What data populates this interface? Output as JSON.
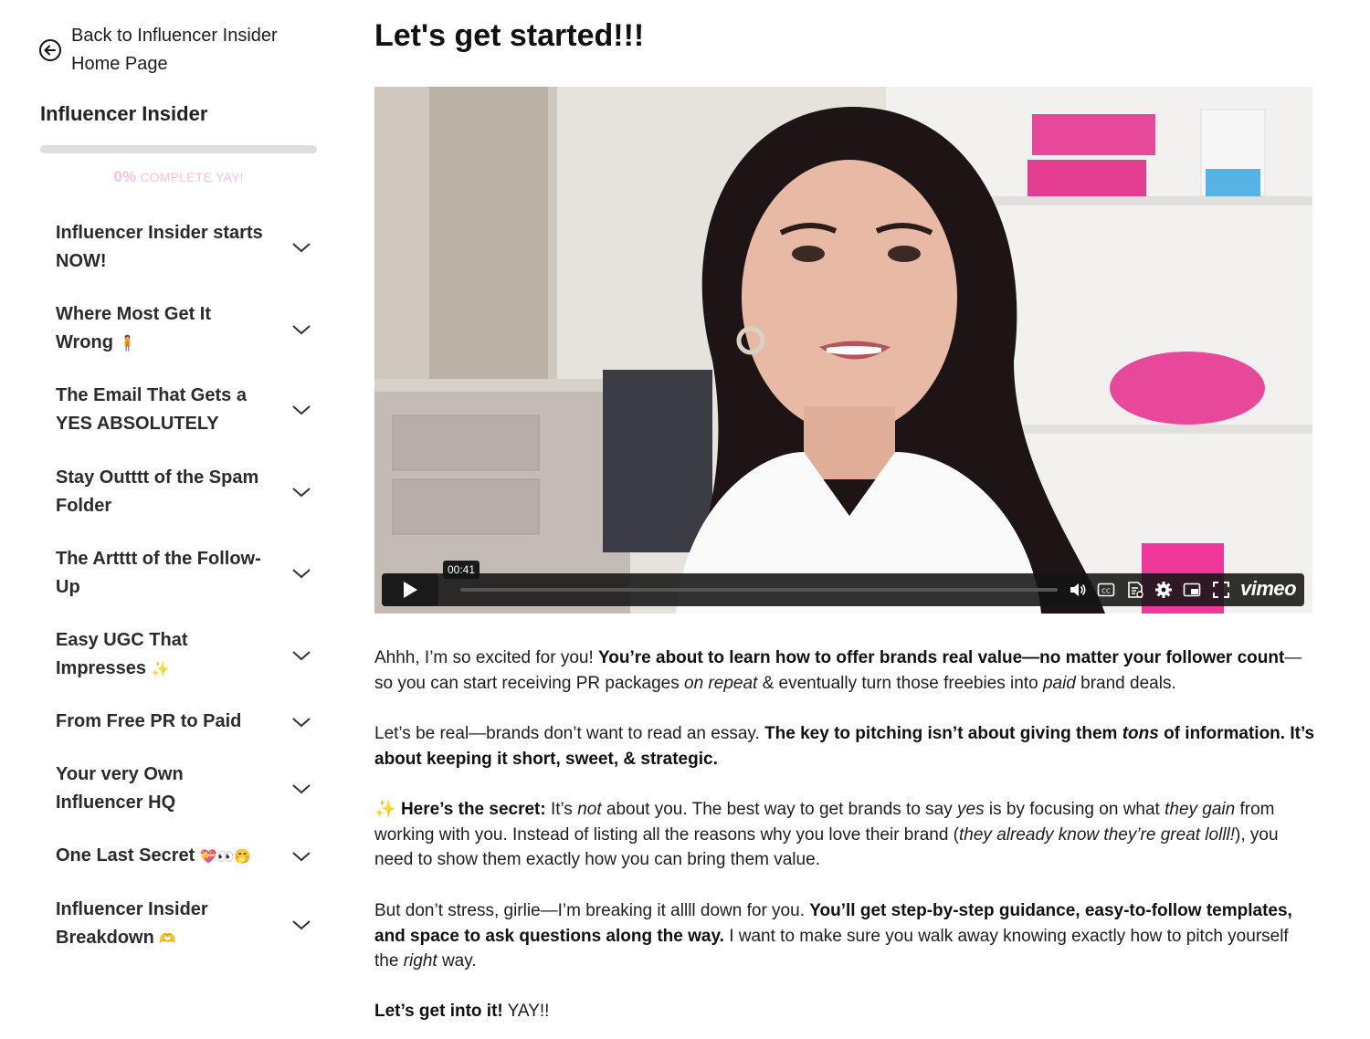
{
  "sidebar": {
    "back_label": "Back to Influencer Insider Home Page",
    "course_title": "Influencer Insider",
    "progress": {
      "percent": 0,
      "percent_label": "0%",
      "suffix": " COMPLETE YAY!"
    },
    "modules": [
      {
        "label": "Influencer Insider starts NOW!"
      },
      {
        "label": "Where Most Get It Wrong",
        "emoji": "🧍"
      },
      {
        "label": "The Email That Gets a YES ABSOLUTELY"
      },
      {
        "label": "Stay Outttt of the Spam Folder"
      },
      {
        "label": "The Artttt of the Follow-Up"
      },
      {
        "label": "Easy UGC That Impresses",
        "emoji": "✨"
      },
      {
        "label": "From Free PR to Paid"
      },
      {
        "label": "Your very Own Influencer HQ"
      },
      {
        "label": "One Last Secret",
        "emoji": "💝👀🤭"
      },
      {
        "label": "Influencer Insider Breakdown",
        "emoji": "🫶"
      }
    ]
  },
  "main": {
    "title": "Let's get started!!!",
    "video": {
      "timestamp": "00:41",
      "progress": 0,
      "brand": "vimeo",
      "control_icons": [
        "volume-icon",
        "captions-icon",
        "transcript-icon",
        "settings-icon",
        "pip-icon",
        "fullscreen-icon"
      ]
    },
    "paragraphs": {
      "p1": {
        "a": "Ahhh, I’m so excited for you! ",
        "b": "You’re about to learn how to offer brands real value—no matter your follower count",
        "c": "—so you can start receiving PR packages ",
        "d": "on repeat",
        "e": " & eventually turn those freebies into ",
        "f": "paid",
        "g": " brand deals."
      },
      "p2": {
        "a": "Let’s be real—brands don’t want to read an essay. ",
        "b": "The key to pitching isn’t about giving them ",
        "c": "tons",
        "d": " of information. It’s about keeping it short, sweet, & strategic."
      },
      "p3": {
        "emoji": "✨",
        "a": " Here’s the secret:",
        "b": " It’s ",
        "c": "not",
        "d": " about you. The best way to get brands to say ",
        "e": "yes",
        "f": " is by focusing on what ",
        "g": "they gain",
        "h": " from working with you. Instead of listing all the reasons why you love their brand (",
        "i": "they already know they’re great lolll!",
        "j": "), you need to show them exactly how you can bring them value."
      },
      "p4": {
        "a": "But don’t stress, girlie—I’m breaking it allll down for you. ",
        "b": "You’ll get step-by-step guidance, easy-to-follow templates, and space to ask questions along the way.",
        "c": " I want to make sure you walk away knowing exactly how to pitch yourself the ",
        "d": "right",
        "e": " way."
      },
      "p5": {
        "a": "Let’s get into it!",
        "b": " YAY!!"
      }
    }
  },
  "colors": {
    "accent_pink": "#f3a6cf",
    "progress_text": "#f7c2de",
    "player_bar": "#141414"
  }
}
